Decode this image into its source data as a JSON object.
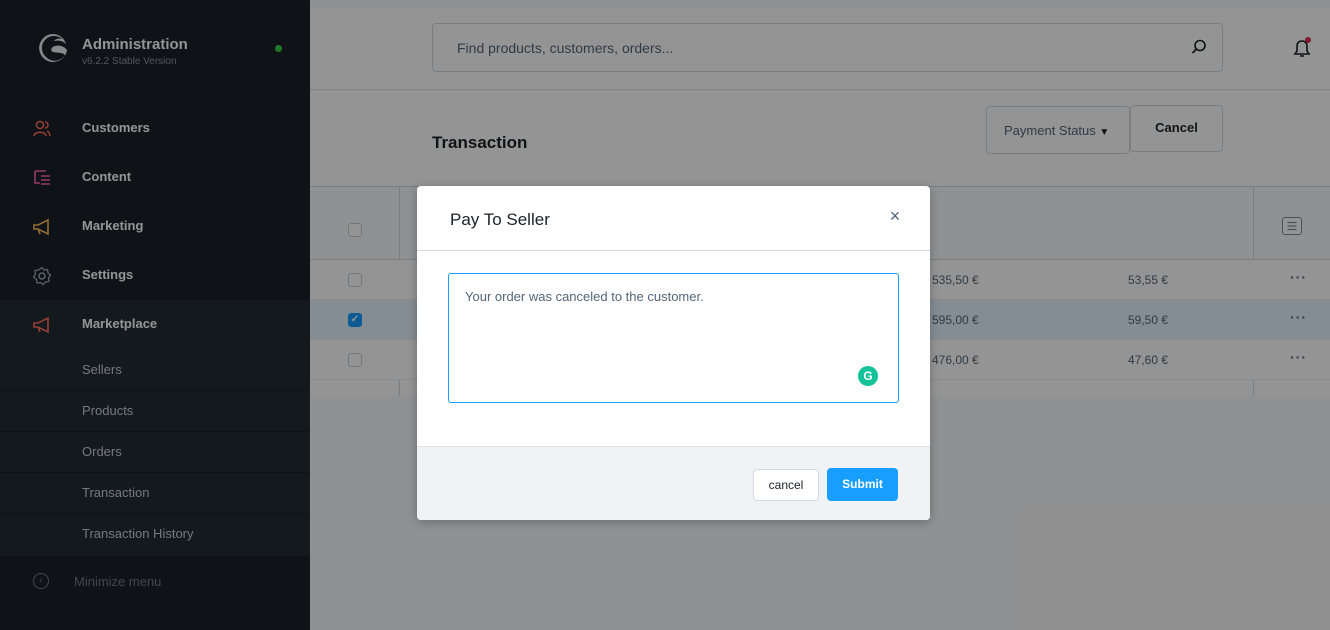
{
  "app": {
    "title": "Administration",
    "version": "v6.2.2 Stable Version",
    "status_color": "#37d046",
    "accent_color": "#189eff"
  },
  "sidebar": {
    "items": [
      {
        "label": "Customers",
        "icon": "customers-icon",
        "color": "#ff6f5e"
      },
      {
        "label": "Content",
        "icon": "content-icon",
        "color": "#ff68b4"
      },
      {
        "label": "Marketing",
        "icon": "megaphone-icon",
        "color": "#ffbd5d"
      },
      {
        "label": "Settings",
        "icon": "gear-icon",
        "color": "#9aa8b5"
      },
      {
        "label": "Marketplace",
        "icon": "megaphone-icon",
        "color": "#ff6f5e"
      }
    ],
    "sub_items": [
      "Sellers",
      "Products",
      "Orders",
      "Transaction",
      "Transaction History"
    ],
    "minimize_label": "Minimize menu"
  },
  "search": {
    "placeholder": "Find products, customers, orders..."
  },
  "page": {
    "title": "Transaction",
    "payment_status_label": "Payment Status",
    "cancel_label": "Cancel"
  },
  "table": {
    "rows": [
      {
        "amount": "535,50 €",
        "commission": "53,55 €",
        "selected": false
      },
      {
        "amount": "595,00 €",
        "commission": "59,50 €",
        "selected": true
      },
      {
        "amount": "476,00 €",
        "commission": "47,60 €",
        "selected": false
      }
    ],
    "row_actions": "···"
  },
  "modal": {
    "title": "Pay To Seller",
    "close_symbol": "×",
    "message_value": "Your order was canceled to the customer.",
    "cancel_label": "cancel",
    "submit_label": "Submit"
  }
}
